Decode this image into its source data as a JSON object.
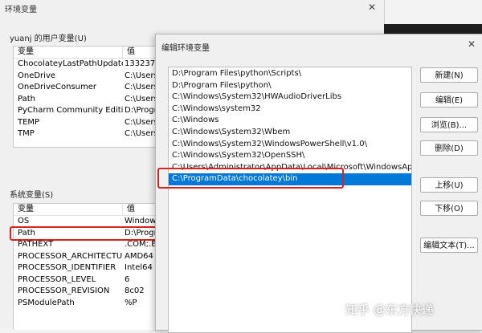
{
  "bg_window": {
    "title": "环境变量",
    "close_glyph": "✕",
    "user_section_label": "yuanj 的用户变量(U)",
    "system_section_label": "系统变量(S)",
    "user_vars": {
      "headers": [
        "变量",
        "值"
      ],
      "rows": [
        [
          "ChocolateyLastPathUpdate",
          "1332371"
        ],
        [
          "OneDrive",
          "C:\\Users\\"
        ],
        [
          "OneDriveConsumer",
          "C:\\Users\\"
        ],
        [
          "Path",
          "C:\\Users\\"
        ],
        [
          "PyCharm Community Edition",
          "D:\\Progra"
        ],
        [
          "TEMP",
          "C:\\Users\\"
        ],
        [
          "TMP",
          "C:\\Users\\"
        ]
      ]
    },
    "system_vars": {
      "headers": [
        "变量",
        "值"
      ],
      "rows": [
        [
          "OS",
          "Windows"
        ],
        [
          "Path",
          "D:\\Progra"
        ],
        [
          "PATHEXT",
          ".COM;.EX"
        ],
        [
          "PROCESSOR_ARCHITECTURE",
          "AMD64"
        ],
        [
          "PROCESSOR_IDENTIFIER",
          "Intel64 F"
        ],
        [
          "PROCESSOR_LEVEL",
          "6"
        ],
        [
          "PROCESSOR_REVISION",
          "8c02"
        ],
        [
          "PSModulePath",
          "%P"
        ]
      ]
    }
  },
  "dialog": {
    "title": "编辑环境变量",
    "close_glyph": "✕",
    "paths": [
      "D:\\Program Files\\python\\Scripts\\",
      "D:\\Program Files\\python\\",
      "C:\\Windows\\System32\\HWAudioDriverLibs",
      "C:\\Windows\\system32",
      "C:\\Windows",
      "C:\\Windows\\System32\\Wbem",
      "C:\\Windows\\System32\\WindowsPowerShell\\v1.0\\",
      "C:\\Windows\\System32\\OpenSSH\\",
      "C:\\Users\\Administrator\\AppData\\Local\\Microsoft\\WindowsApps",
      "C:\\ProgramData\\chocolatey\\bin"
    ],
    "selected_index": 9,
    "buttons": {
      "new": "新建(N)",
      "edit": "编辑(E)",
      "browse": "浏览(B)...",
      "delete": "删除(D)",
      "move_up": "上移(U)",
      "move_down": "下移(O)",
      "edit_text": "编辑文本(T)..."
    }
  },
  "watermark": "知乎 @东方快递",
  "colors": {
    "selection": "#0078d7",
    "annotation": "#d9231d"
  }
}
